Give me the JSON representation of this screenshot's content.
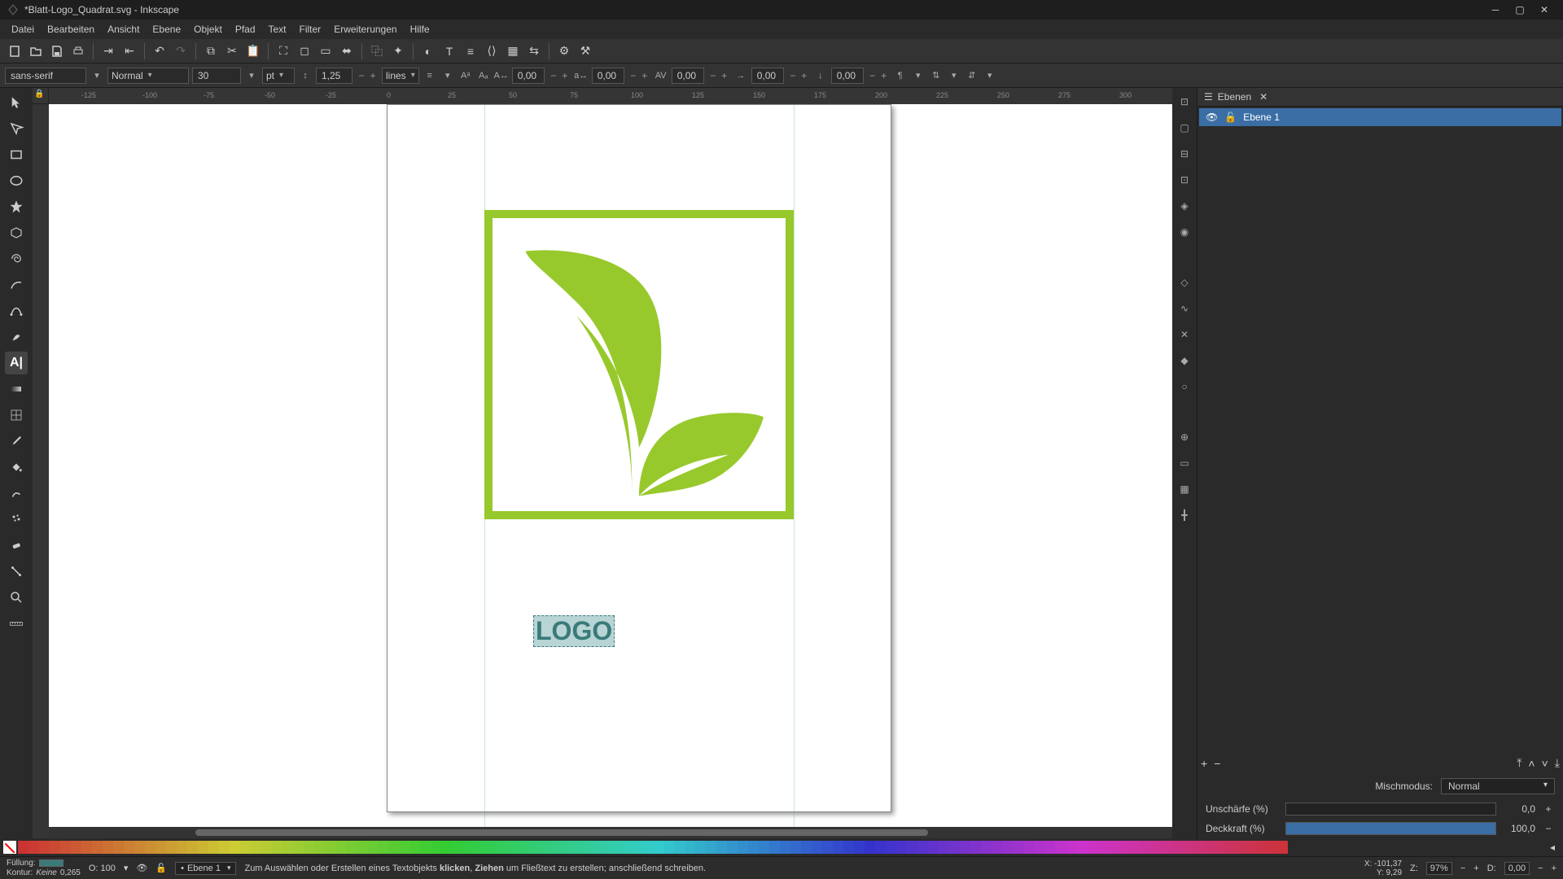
{
  "window": {
    "title": "*Blatt-Logo_Quadrat.svg - Inkscape"
  },
  "menu": [
    "Datei",
    "Bearbeiten",
    "Ansicht",
    "Ebene",
    "Objekt",
    "Pfad",
    "Text",
    "Filter",
    "Erweiterungen",
    "Hilfe"
  ],
  "text_tool": {
    "font_family": "sans-serif",
    "font_style": "Normal",
    "font_size": "30",
    "size_unit": "pt",
    "line_height": "1,25",
    "line_unit": "lines",
    "word_spacing": "0,00",
    "letter_spacing": "0,00",
    "kerning": "0,00",
    "dx": "0,00",
    "dy": "0,00"
  },
  "ruler_labels": [
    "-125",
    "-100",
    "-75",
    "-50",
    "-25",
    "0",
    "25",
    "50",
    "75",
    "100",
    "125",
    "150",
    "175",
    "200",
    "225",
    "250",
    "275",
    "300"
  ],
  "canvas": {
    "logo_text": "LOGO"
  },
  "layers_panel": {
    "title": "Ebenen",
    "layer1": "Ebene 1",
    "blend_label": "Mischmodus:",
    "blend_value": "Normal",
    "blur_label": "Unschärfe (%)",
    "blur_value": "0,0",
    "opacity_label": "Deckkraft (%)",
    "opacity_value": "100,0"
  },
  "status": {
    "fill_label": "Füllung:",
    "stroke_label": "Kontur:",
    "stroke_value": "Keine",
    "stroke_width": "0,265",
    "opacity_o": "O: 100",
    "layer": "Ebene 1",
    "message_pre": "Zum Auswählen oder Erstellen eines Textobjekts ",
    "message_b1": "klicken",
    "message_mid": ", ",
    "message_b2": "Ziehen",
    "message_post": " um Fließtext zu erstellen; anschließend schreiben.",
    "coord_x": "X: -101,37",
    "coord_y": "Y:    9,29",
    "zoom": "97%",
    "z_label": "Z:",
    "d_label": "D:",
    "rotation": "0,00"
  }
}
